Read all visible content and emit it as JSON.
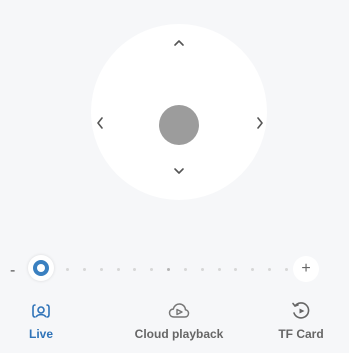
{
  "ptz": {
    "up_icon": "chevron-up-icon",
    "down_icon": "chevron-down-icon",
    "left_icon": "chevron-left-icon",
    "right_icon": "chevron-right-icon",
    "center_color": "#9c9c9c"
  },
  "zoom": {
    "minus_label": "-",
    "plus_label": "+",
    "level": 0
  },
  "nav": {
    "active_color": "#2f73b8",
    "inactive_color": "#666666",
    "items": [
      {
        "label": "Live",
        "icon": "live-camera-icon",
        "active": true
      },
      {
        "label": "Cloud playback",
        "icon": "cloud-playback-icon",
        "active": false
      },
      {
        "label": "TF Card",
        "icon": "tf-card-playback-icon",
        "active": false
      }
    ]
  }
}
